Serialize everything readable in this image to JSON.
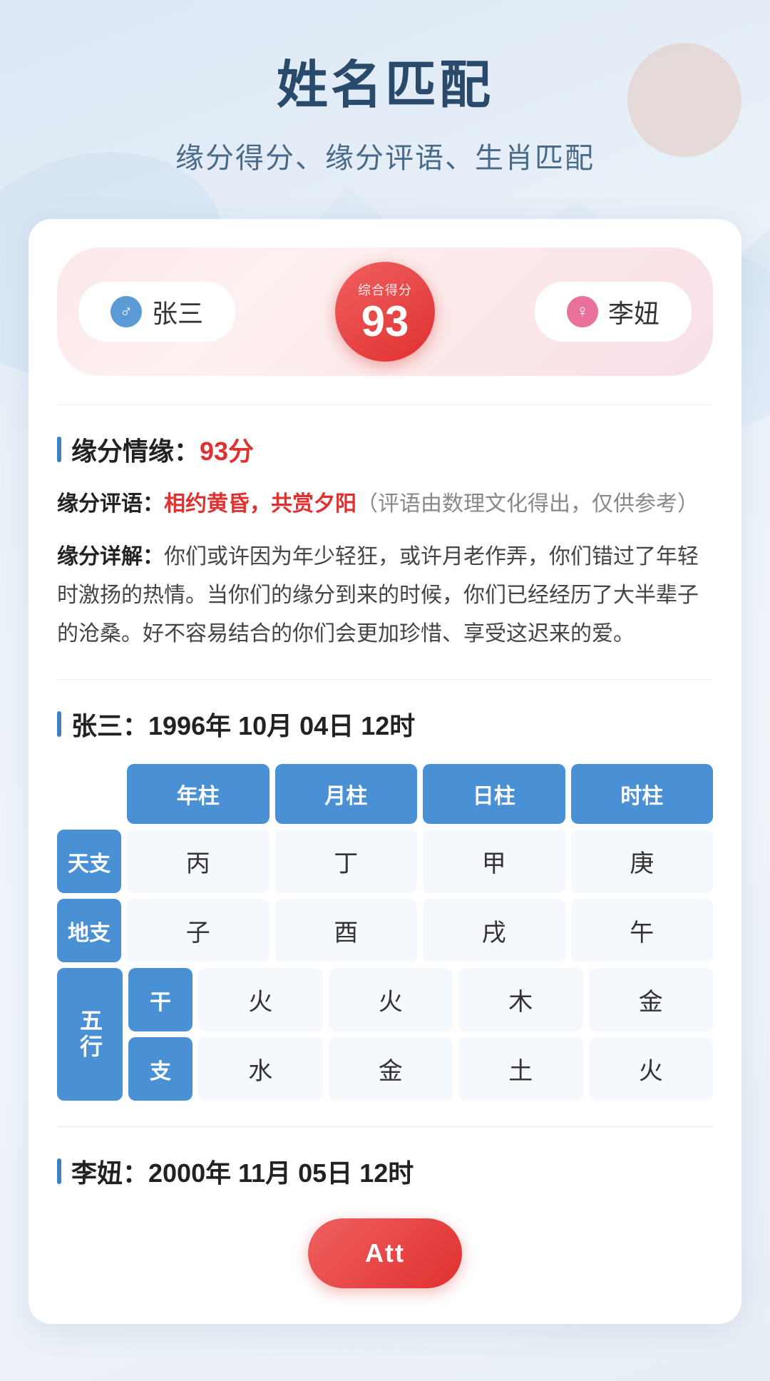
{
  "page": {
    "title": "姓名匹配",
    "subtitle": "缘分得分、缘分评语、生肖匹配"
  },
  "score_banner": {
    "person1": {
      "name": "张三",
      "gender": "male",
      "icon": "♂"
    },
    "person2": {
      "name": "李妞",
      "gender": "female",
      "icon": "♀"
    },
    "score_label": "综合得分",
    "score_value": "93"
  },
  "yuanfen": {
    "section_title": "缘分情缘：",
    "section_score": "93分",
    "label_pinyu": "缘分评语：",
    "highlight_text": "相约黄昏，共赏夕阳",
    "note_text": "（评语由数理文化得出，仅供参考）",
    "label_detail": "缘分详解：",
    "detail_text": "你们或许因为年少轻狂，或许月老作弄，你们错过了年轻时激扬的热情。当你们的缘分到来的时候，你们已经经历了大半辈子的沧桑。好不容易结合的你们会更加珍惜、享受这迟来的爱。"
  },
  "person1_bazi": {
    "section_title": "张三：",
    "date_text": "1996年 10月 04日 12时",
    "headers": [
      "年柱",
      "月柱",
      "日柱",
      "时柱"
    ],
    "row_tianган": {
      "label": "天支",
      "values": [
        "丙",
        "丁",
        "甲",
        "庚"
      ]
    },
    "row_dizhi": {
      "label": "地支",
      "values": [
        "子",
        "酉",
        "戌",
        "午"
      ]
    },
    "wuxing_label": "五行",
    "row_gan": {
      "label": "干",
      "values": [
        "火",
        "火",
        "木",
        "金"
      ]
    },
    "row_zhi": {
      "label": "支",
      "values": [
        "水",
        "金",
        "土",
        "火"
      ]
    }
  },
  "person2_bazi": {
    "section_title": "李妞：",
    "date_text": "2000年 11月 05日 12时"
  },
  "button": {
    "label": "Att"
  }
}
